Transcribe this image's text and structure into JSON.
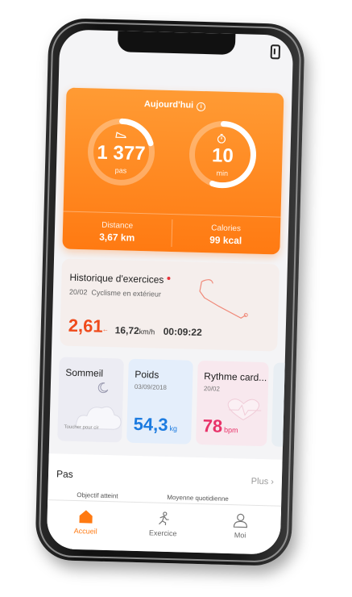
{
  "today": {
    "title": "Aujourd'hui",
    "info_icon": "info-icon",
    "steps": {
      "value": "1 377",
      "unit": "pas",
      "icon": "shoe-icon",
      "progress": 0.2
    },
    "minutes": {
      "value": "10",
      "unit": "min",
      "icon": "stopwatch-icon",
      "progress": 0.55
    },
    "distance": {
      "label": "Distance",
      "value": "3,67 km"
    },
    "calories": {
      "label": "Calories",
      "value": "99 kcal"
    }
  },
  "history": {
    "title": "Historique d'exercices",
    "date": "20/02",
    "activity": "Cyclisme en extérieur",
    "distance": "2,61",
    "speed": "16,72",
    "speed_unit": "km/h",
    "duration": "00:09:22"
  },
  "tiles": {
    "sleep": {
      "title": "Sommeil",
      "hint": "Toucher pour cir",
      "icon": "moon-icon"
    },
    "weight": {
      "title": "Poids",
      "date": "03/09/2018",
      "value": "54,3",
      "unit": "kg"
    },
    "heart": {
      "title": "Rythme card...",
      "date": "20/02",
      "value": "78",
      "unit": "bpm"
    }
  },
  "pas": {
    "title": "Pas",
    "more": "Plus",
    "sub1": "Objectif atteint",
    "sub2": "Moyenne quotidienne"
  },
  "tabs": [
    {
      "label": "Accueil",
      "icon": "home-icon"
    },
    {
      "label": "Exercice",
      "icon": "runner-icon"
    },
    {
      "label": "Moi",
      "icon": "person-icon"
    }
  ],
  "colors": {
    "accent": "#ff7a12",
    "distance": "#ef4a1b",
    "weight": "#1c7be0",
    "heart": "#e8336a"
  }
}
